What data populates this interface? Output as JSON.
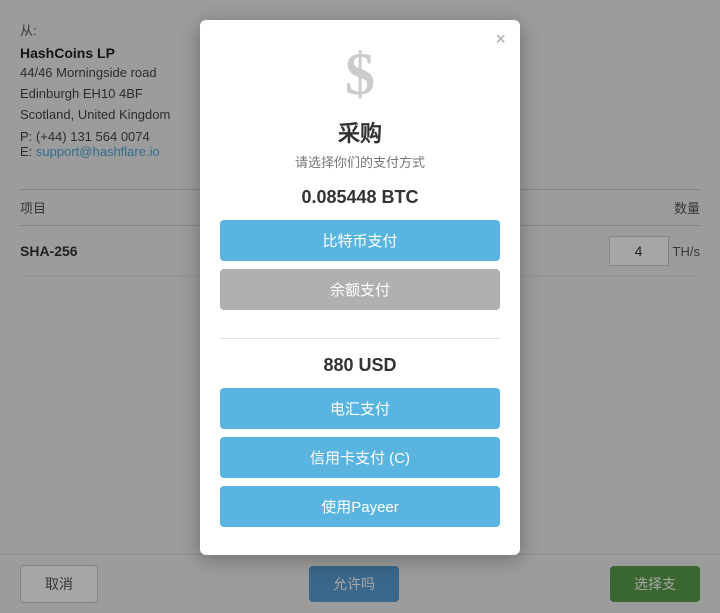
{
  "background": {
    "from_label": "从:",
    "company_name": "HashCoins LP",
    "address_line1": "44/46 Morningside road",
    "address_line2": "Edinburgh EH10 4BF",
    "address_line3": "Scotland, United Kingdom",
    "phone": "P: (+44) 131 564 0074",
    "email_label": "E:",
    "email": "support@hashflare.io",
    "table_col1": "项目",
    "table_col2": "数量",
    "row_item": "SHA-256",
    "row_qty": "4",
    "row_unit": "TH/s"
  },
  "buttons": {
    "cancel": "取消",
    "next": "允许吗",
    "select": "选择支"
  },
  "modal": {
    "close": "×",
    "icon": "$",
    "title": "采购",
    "subtitle": "请选择你们的支付方式",
    "btc_amount": "0.085448 BTC",
    "btn_bitcoin": "比特币支付",
    "btn_balance": "余额支付",
    "usd_amount": "880 USD",
    "btn_wire": "电汇支付",
    "btn_card": "信用卡支付 (C)",
    "btn_payeer": "使用Payeer"
  }
}
